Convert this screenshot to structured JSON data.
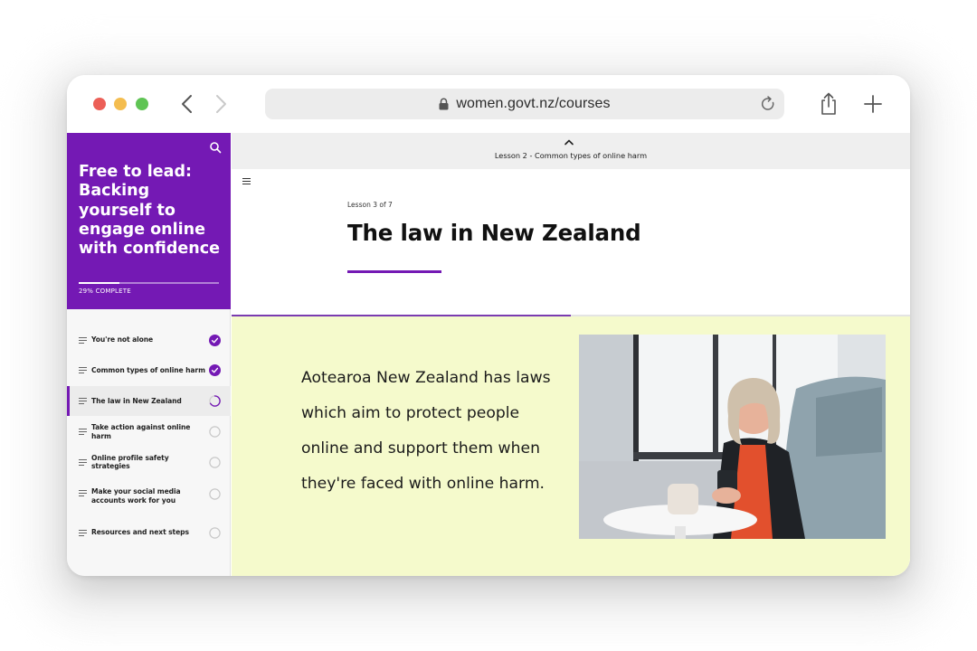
{
  "browser": {
    "url": "women.govt.nz/courses"
  },
  "sidebar": {
    "course_title": "Free to lead: Backing yourself to engage online with confidence",
    "progress_percent": 29,
    "progress_label": "29% COMPLETE",
    "accent_color": "#7419b4",
    "lessons": [
      {
        "label": "You're not alone",
        "status": "complete"
      },
      {
        "label": "Common types of online harm",
        "status": "complete"
      },
      {
        "label": "The law in New Zealand",
        "status": "in-progress"
      },
      {
        "label": "Take action against online harm",
        "status": "not-started"
      },
      {
        "label": "Online profile safety strategies",
        "status": "not-started"
      },
      {
        "label": "Make your social media accounts work for you",
        "status": "not-started"
      },
      {
        "label": "Resources and next steps",
        "status": "not-started"
      }
    ]
  },
  "main": {
    "previous_lesson_label": "Lesson 2 - Common types of online harm",
    "lesson_count": "Lesson 3 of 7",
    "title": "The law in New Zealand",
    "body": "Aotearoa New Zealand has laws which aim to protect people online and support them when they're faced with online harm.",
    "content_background": "#f5facc",
    "scroll_progress_fraction": 0.5
  },
  "icons": [
    "back-icon",
    "forward-icon",
    "lock-icon",
    "reload-icon",
    "share-icon",
    "plus-icon",
    "search-icon",
    "menu-icon",
    "lines-icon",
    "check-circle-icon",
    "partial-circle-icon",
    "empty-circle-icon",
    "chevron-up-icon"
  ]
}
